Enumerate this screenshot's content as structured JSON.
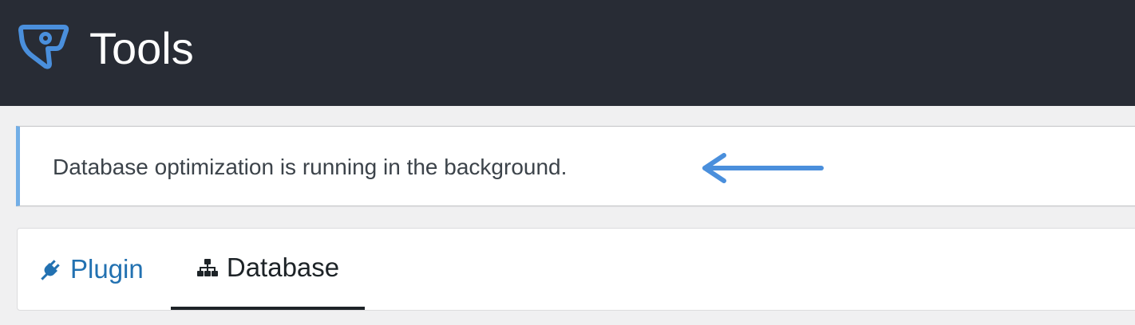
{
  "header": {
    "logo_icon": "shield-chat-logo-icon",
    "title": "Tools",
    "background": "#282c35",
    "logo_color": "#4a8fdc"
  },
  "notice": {
    "message": "Database optimization is running in the background.",
    "arrow_icon": "arrow-left-icon",
    "accent": "#72aee6"
  },
  "tabs": [
    {
      "label": "Plugin",
      "icon": "plug-icon",
      "active": false,
      "color": "#2271b1"
    },
    {
      "label": "Database",
      "icon": "sitemap-icon",
      "active": true,
      "color": "#1d2327"
    }
  ]
}
